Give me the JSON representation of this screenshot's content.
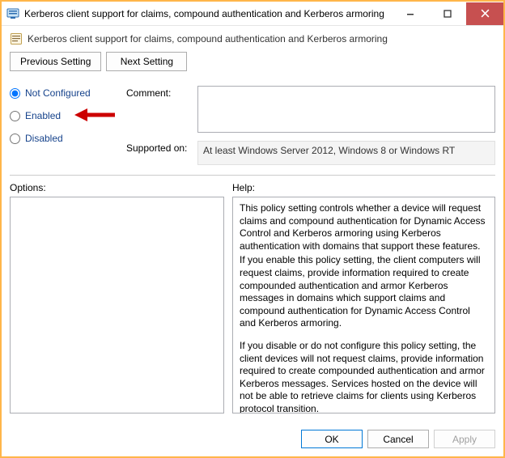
{
  "window": {
    "title": "Kerberos client support for claims, compound authentication and Kerberos armoring"
  },
  "subheader": {
    "title": "Kerberos client support for claims, compound authentication and Kerberos armoring"
  },
  "nav": {
    "previous": "Previous Setting",
    "next": "Next Setting"
  },
  "radios": {
    "not_configured": "Not Configured",
    "enabled": "Enabled",
    "disabled": "Disabled",
    "selected": "not_configured"
  },
  "meta": {
    "comment_label": "Comment:",
    "comment_value": "",
    "supported_label": "Supported on:",
    "supported_value": "At least Windows Server 2012, Windows 8 or Windows RT"
  },
  "panes": {
    "options_label": "Options:",
    "help_label": "Help:",
    "help_p1": "This policy setting controls whether a device will request claims and compound authentication for Dynamic Access Control and Kerberos armoring using Kerberos authentication with domains that support these features.",
    "help_p2": "If you enable this policy setting, the client computers will request claims, provide information required to create compounded authentication and armor Kerberos messages in domains which support claims and compound authentication for Dynamic Access Control and Kerberos armoring.",
    "help_p3": "If you disable or do not configure this policy setting, the client devices will not request claims, provide information required to create compounded authentication and armor Kerberos messages. Services hosted on the device will not be able to retrieve claims for clients using Kerberos protocol transition."
  },
  "buttons": {
    "ok": "OK",
    "cancel": "Cancel",
    "apply": "Apply"
  }
}
